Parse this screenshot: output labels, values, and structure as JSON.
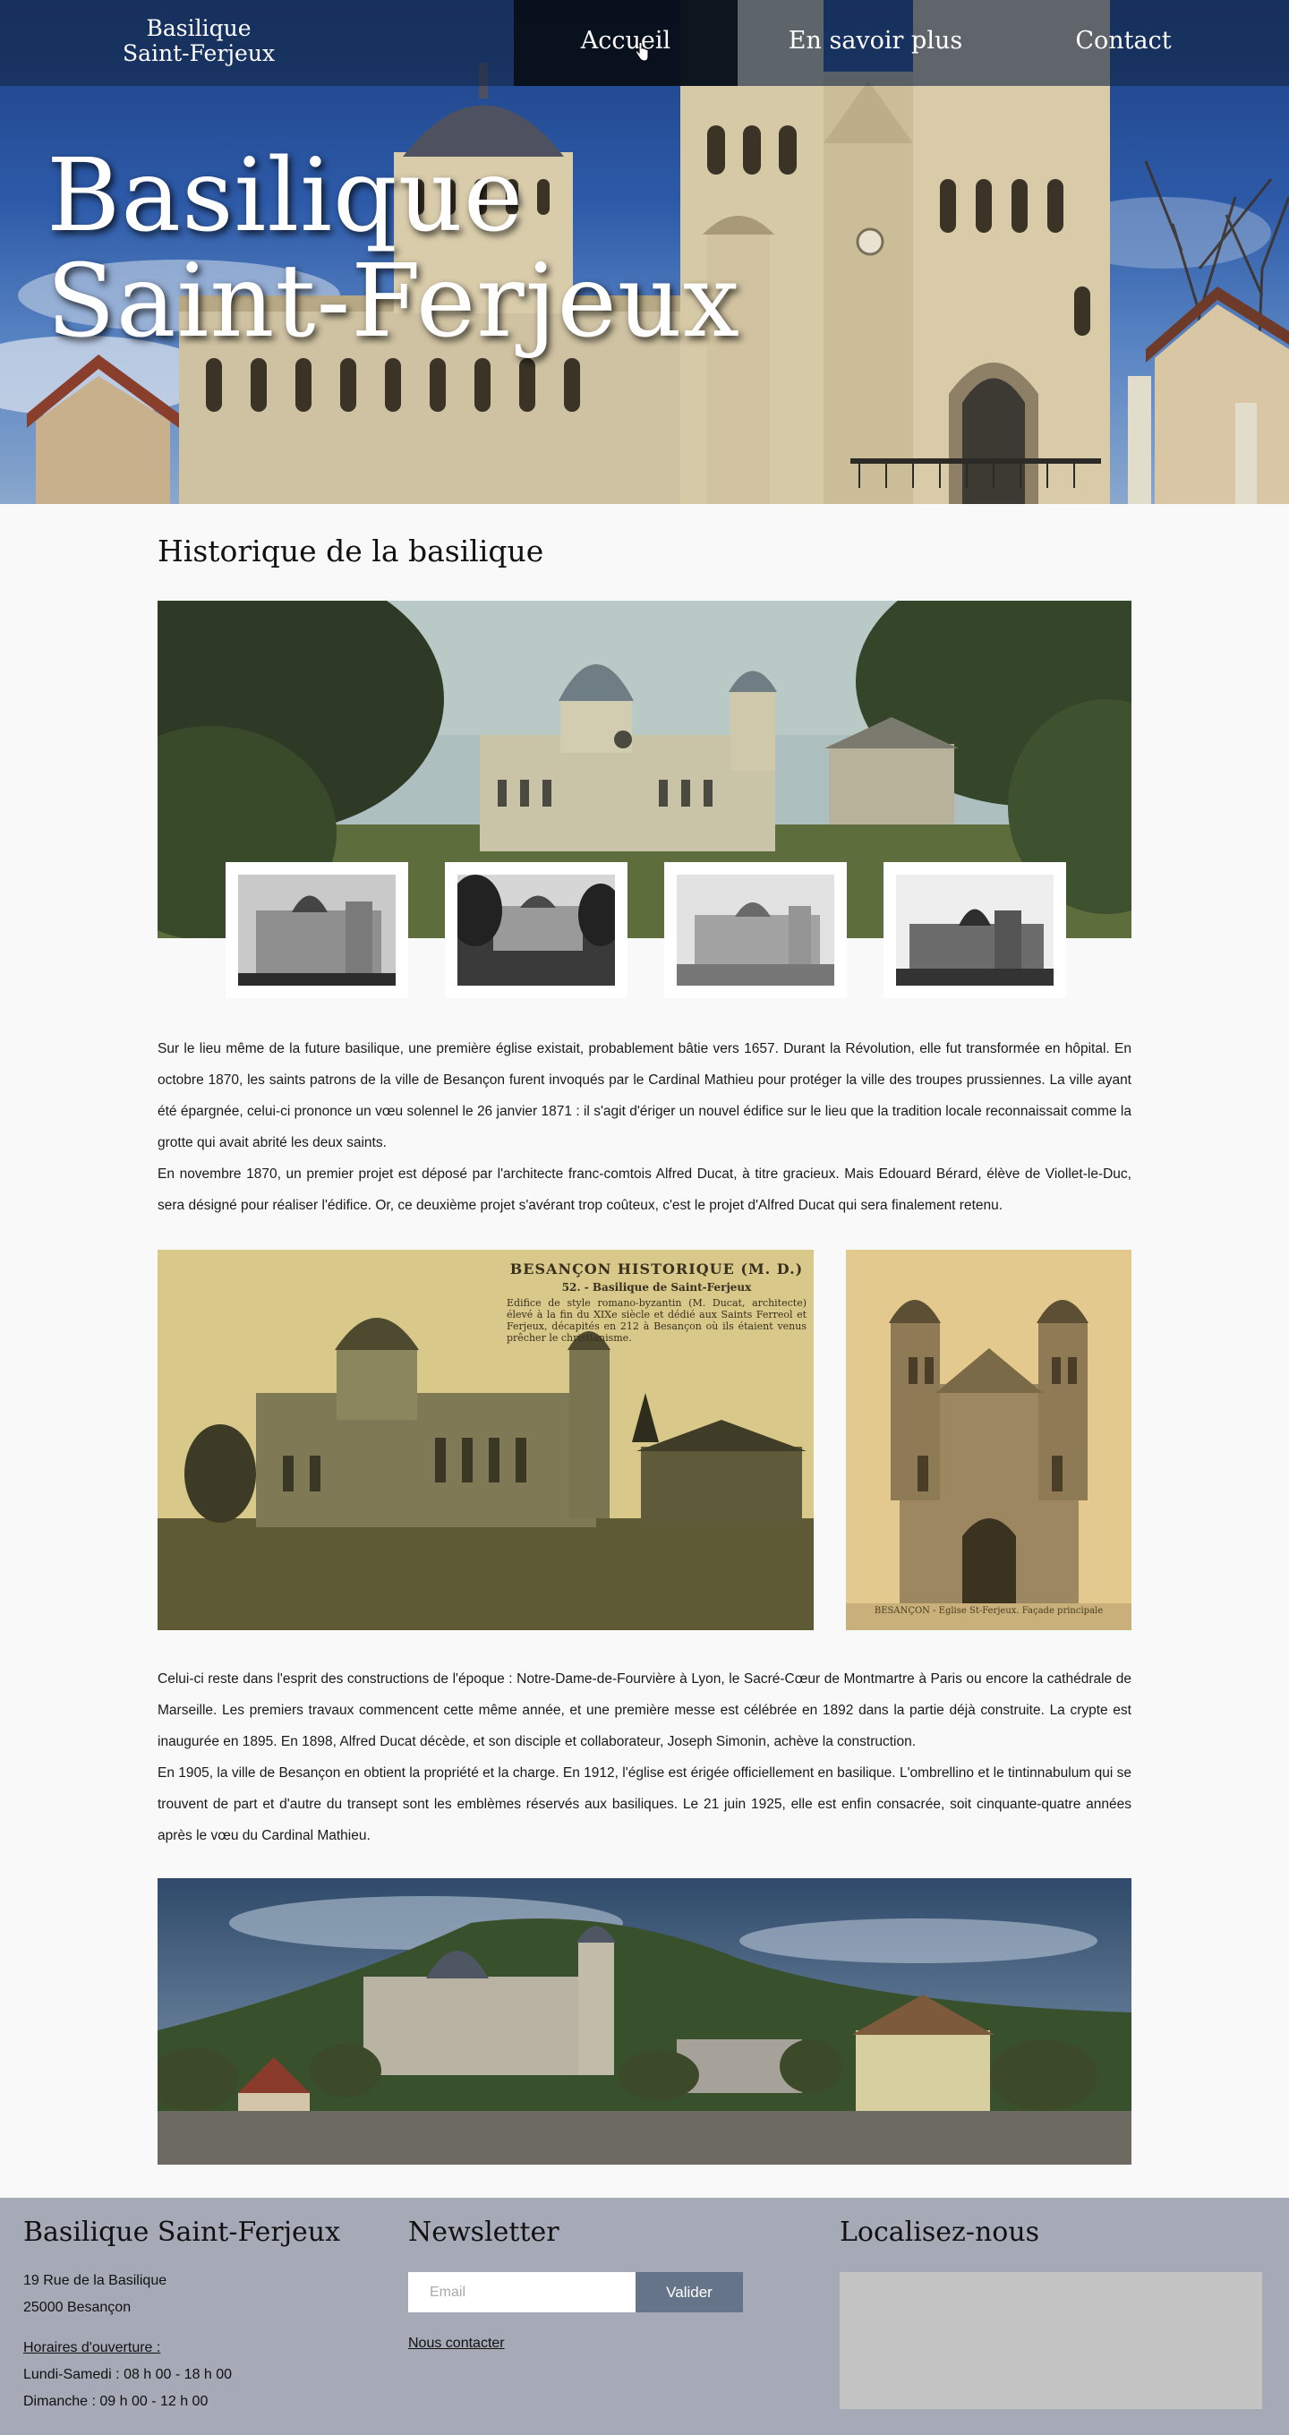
{
  "header": {
    "brand_line1": "Basilique",
    "brand_line2": "Saint-Ferjeux",
    "nav": {
      "home": "Accueil",
      "more": "En savoir plus",
      "contact": "Contact"
    },
    "hero_title_line1": "Basilique",
    "hero_title_line2": "Saint-Ferjeux"
  },
  "main": {
    "section_title": "Historique de la basilique",
    "postcard_caption_title": "BESANÇON HISTORIQUE (M. D.)",
    "postcard_caption_sub": "52. - Basilique de Saint-Ferjeux",
    "postcard_caption_body": "Edifice de style romano-byzantin (M. Ducat, architecte) élevé à la fin du XIXe siècle et dédié aux Saints Ferreol et Ferjeux, décapités en 212 à Besançon où ils étaient venus prêcher le christianisme.",
    "facade_caption": "BESANÇON - Eglise St-Ferjeux. Façade principale",
    "paragraph1": [
      "Sur le lieu même de la future basilique, une première église existait, probablement bâtie vers 1657. Durant la Révolution, elle fut transformée en hôpital. En octobre 1870, les saints patrons de la ville de Besançon furent invoqués par le Cardinal Mathieu pour protéger la ville des troupes prussiennes. La ville ayant été épargnée, celui-ci prononce un vœu solennel le 26 janvier 1871 : il s'agit d'ériger un nouvel édifice sur le lieu que la tradition locale reconnaissait comme la grotte qui avait abrité les deux saints.",
      "En novembre 1870, un premier projet est déposé par l'architecte franc-comtois Alfred Ducat, à titre gracieux. Mais Edouard Bérard, élève de Viollet-le-Duc, sera désigné pour réaliser l'édifice. Or, ce deuxième projet s'avérant trop coûteux, c'est le projet d'Alfred Ducat qui sera finalement retenu."
    ],
    "paragraph2": [
      "Celui-ci reste dans l'esprit des constructions de l'époque : Notre-Dame-de-Fourvière à Lyon, le Sacré-Cœur de Montmartre à Paris ou encore la cathédrale de Marseille. Les premiers travaux commencent cette même année, et une première messe est célébrée en 1892 dans la partie déjà construite. La crypte est inaugurée en 1895. En 1898, Alfred Ducat décède, et son disciple et collaborateur, Joseph Simonin, achève la construction.",
      "En 1905, la ville de Besançon en obtient la propriété et la charge. En 1912, l'église est érigée officiellement en basilique. L'ombrellino et le tintinnabulum qui se trouvent de part et d'autre du transept sont les emblèmes réservés aux basiliques. Le 21 juin 1925, elle est enfin consacrée, soit cinquante-quatre années après le vœu du Cardinal Mathieu."
    ]
  },
  "footer": {
    "title": "Basilique Saint-Ferjeux",
    "address_line1": "19 Rue de la Basilique",
    "address_line2": "25000 Besançon",
    "hours_label": "Horaires d'ouverture :",
    "hours_weekdays": "Lundi-Samedi : 08 h 00 - 18 h 00",
    "hours_sunday": "Dimanche : 09 h 00 - 12 h 00",
    "newsletter_title": "Newsletter",
    "email_placeholder": "Email",
    "validate_label": "Valider",
    "contact_link": "Nous contacter",
    "locate_title": "Localisez-nous"
  },
  "colors": {
    "navbar": "#142646",
    "nav_active": "#080e18",
    "page_bg": "#f9f9f9",
    "footer_bg": "#a5aab6",
    "button_bg": "#66748a",
    "map_placeholder": "#c4c4c4"
  }
}
